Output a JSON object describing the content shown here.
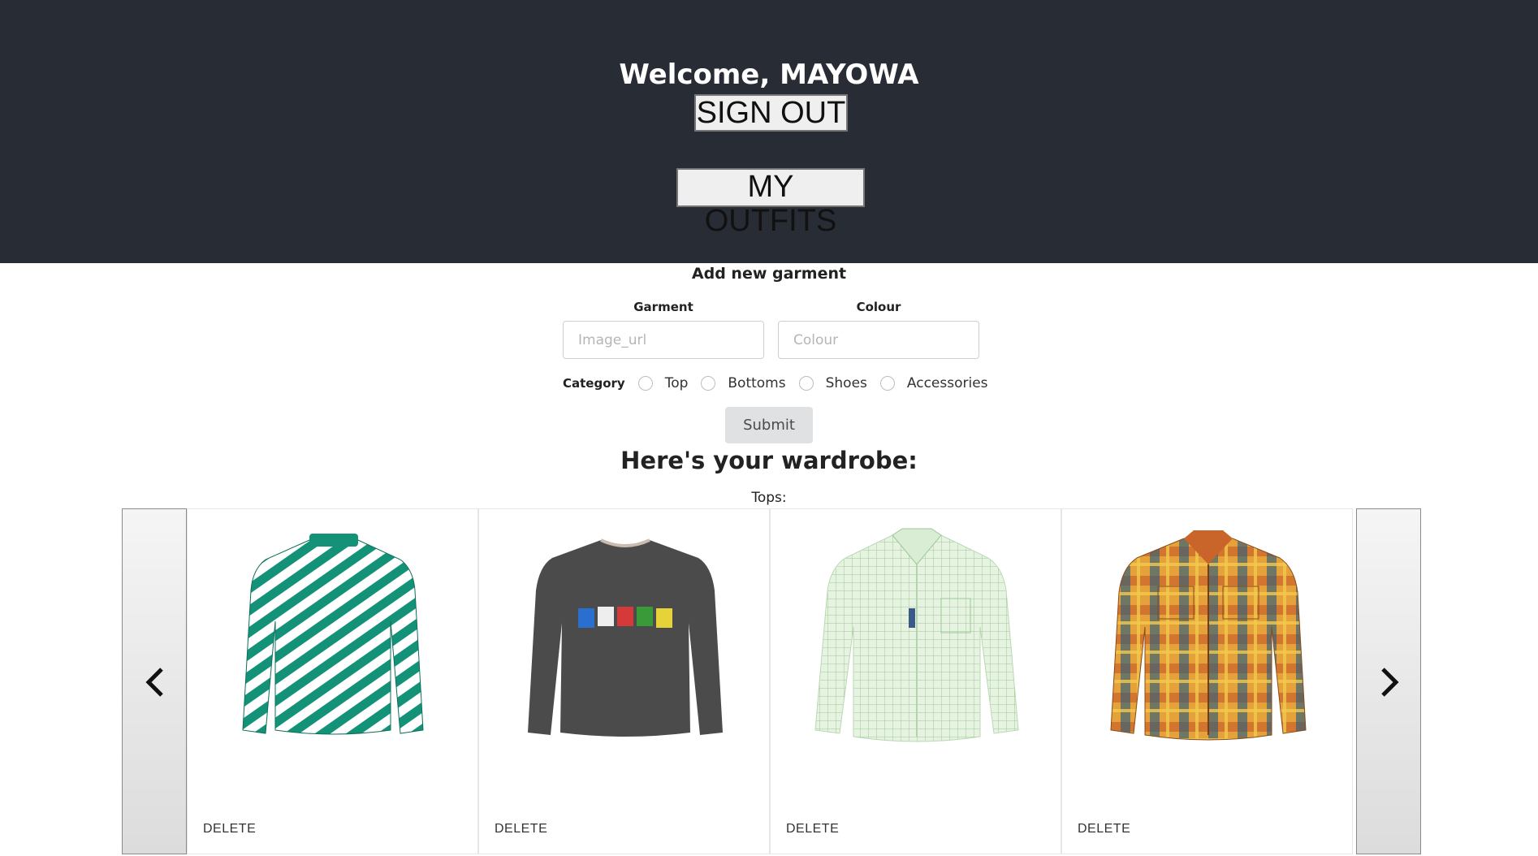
{
  "header": {
    "welcome": "Welcome, MAYOWA",
    "sign_out_label": "SIGN OUT",
    "my_outfits_label": "MY OUTFITS",
    "background": "#282c34"
  },
  "form": {
    "title": "Add new garment",
    "garment_label": "Garment",
    "garment_placeholder": "Image_url",
    "colour_label": "Colour",
    "colour_placeholder": "Colour",
    "category_label": "Category",
    "categories": [
      "Top",
      "Bottoms",
      "Shoes",
      "Accessories"
    ],
    "submit_label": "Submit"
  },
  "wardrobe": {
    "title": "Here's your wardrobe:",
    "section_label": "Tops:",
    "prev_icon": "chevron-left-icon",
    "next_icon": "chevron-right-icon",
    "items": [
      {
        "image": "green-patterned-blouse",
        "delete_label": "DELETE",
        "color": "#1a9a7c"
      },
      {
        "image": "dark-grey-long-sleeve-tee",
        "delete_label": "DELETE",
        "color": "#4a4a4a"
      },
      {
        "image": "light-green-check-shirt",
        "delete_label": "DELETE",
        "color": "#cfe8c8"
      },
      {
        "image": "orange-plaid-flannel-shirt",
        "delete_label": "DELETE",
        "color": "#d8872a"
      }
    ]
  }
}
